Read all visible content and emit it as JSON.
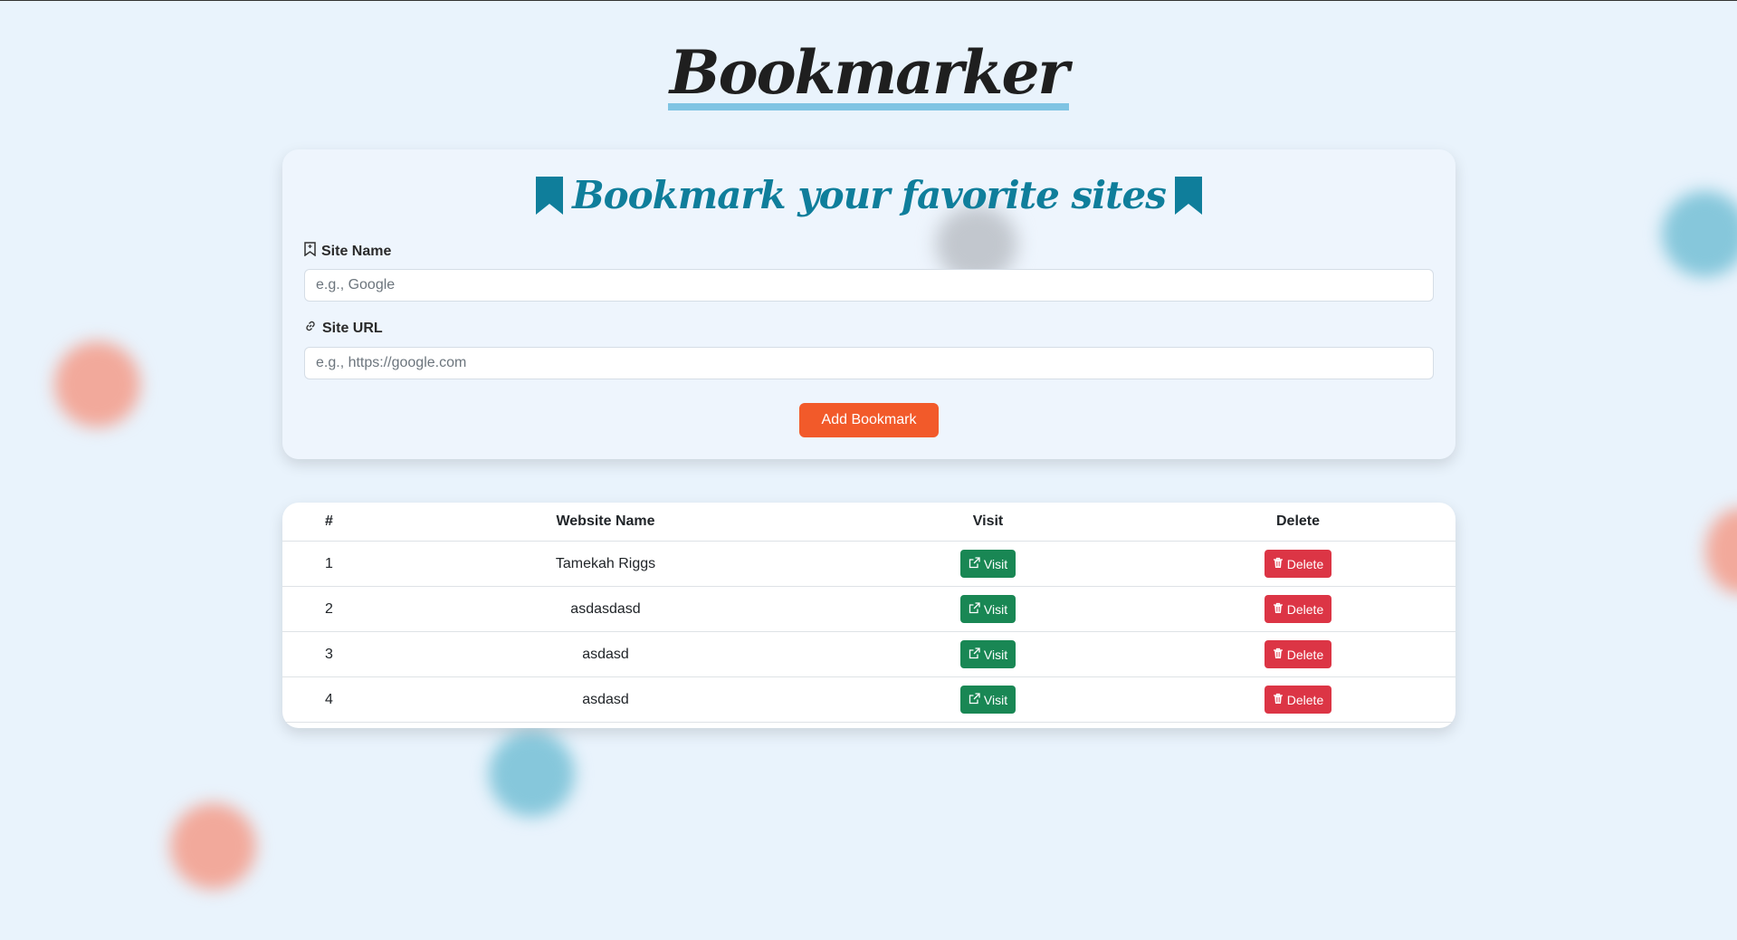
{
  "app": {
    "title": "Bookmarker"
  },
  "form": {
    "heading": "Bookmark your favorite sites",
    "site_name_label": "Site Name",
    "site_name_placeholder": "e.g., Google",
    "site_name_value": "",
    "site_url_label": "Site URL",
    "site_url_placeholder": "e.g., https://google.com",
    "site_url_value": "",
    "submit_label": "Add Bookmark"
  },
  "table": {
    "headers": [
      "#",
      "Website Name",
      "Visit",
      "Delete"
    ],
    "rows": [
      {
        "index": "1",
        "name": "Tamekah Riggs",
        "visit": "Visit",
        "delete": "Delete"
      },
      {
        "index": "2",
        "name": "asdasdasd",
        "visit": "Visit",
        "delete": "Delete"
      },
      {
        "index": "3",
        "name": "asdasd",
        "visit": "Visit",
        "delete": "Delete"
      },
      {
        "index": "4",
        "name": "asdasd",
        "visit": "Visit",
        "delete": "Delete"
      }
    ]
  },
  "icons": {
    "heading_left": "bookmark-icon",
    "heading_right": "bookmark-icon",
    "site_name": "bookmark-outline-icon",
    "site_url": "link-icon",
    "visit": "external-link-icon",
    "delete": "trash-icon"
  },
  "colors": {
    "background": "#e9f3fc",
    "title_underline": "#7fc4e3",
    "heading": "#0f7e9b",
    "add_button": "#f25a2a",
    "visit_button": "#198754",
    "delete_button": "#dc3545"
  }
}
